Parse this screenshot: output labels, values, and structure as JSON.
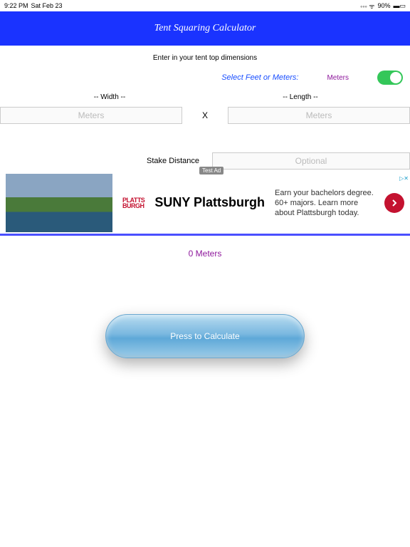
{
  "status": {
    "time": "9:22 PM",
    "date": "Sat Feb 23",
    "battery": "90%"
  },
  "header": {
    "title": "Tent Squaring Calculator"
  },
  "instruction": "Enter in your tent top dimensions",
  "unit": {
    "label": "Select Feet or Meters:",
    "value": "Meters"
  },
  "dimensions": {
    "width_label": "-- Width --",
    "length_label": "-- Length --",
    "width_placeholder": "Meters",
    "length_placeholder": "Meters",
    "separator": "X"
  },
  "stake": {
    "label": "Stake Distance",
    "placeholder": "Optional"
  },
  "ad": {
    "test_label": "Test Ad",
    "logo_line1": "PLATTS",
    "logo_line2": "BURGH",
    "title": "SUNY Plattsburgh",
    "description": "Earn your bachelors degree. 60+ majors. Learn more about Plattsburgh today.",
    "marker": "▷✕"
  },
  "result": "0 Meters",
  "calculate_label": "Press to Calculate"
}
